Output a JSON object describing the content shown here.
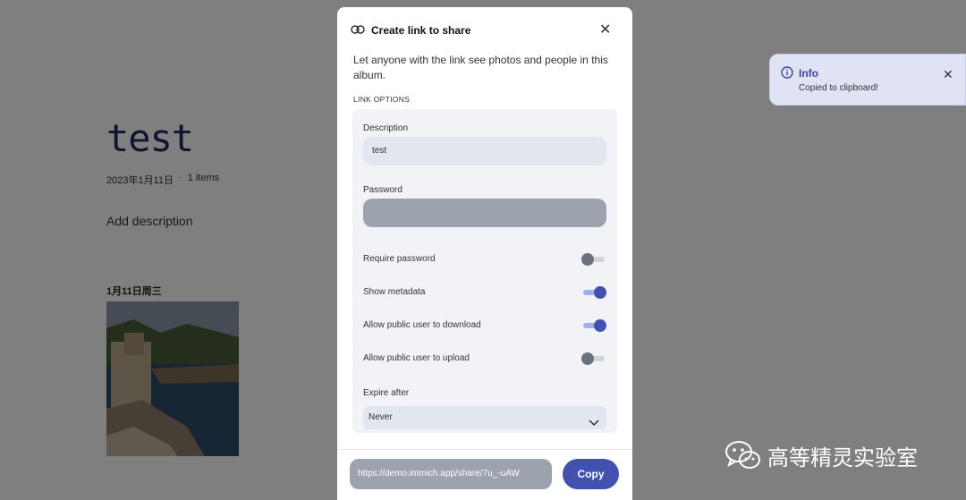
{
  "album": {
    "title": "test",
    "date": "2023年1月11日",
    "separator": "·",
    "item_count": "1 items",
    "add_description": "Add description",
    "group_date": "1月11日周三"
  },
  "toast": {
    "title": "Info",
    "message": "Copied to clipboard!",
    "icon": "info-icon",
    "close_icon": "close-icon"
  },
  "modal": {
    "title": "Create link to share",
    "description": "Let anyone with the link see photos and people in this album.",
    "options_label": "LINK OPTIONS",
    "description_field": {
      "label": "Description",
      "value": "test"
    },
    "password_field": {
      "label": "Password",
      "value": ""
    },
    "toggles": [
      {
        "label": "Require password",
        "on": false
      },
      {
        "label": "Show metadata",
        "on": true
      },
      {
        "label": "Allow public user to download",
        "on": true
      },
      {
        "label": "Allow public user to upload",
        "on": false
      }
    ],
    "expire": {
      "label": "Expire after",
      "value": "Never"
    },
    "share_url": "https://demo.immich.app/share/7u_-uAW",
    "copy_label": "Copy"
  },
  "watermark": {
    "text": "高等精灵实验室"
  },
  "colors": {
    "accent": "#4250af",
    "title": "#1e2a63",
    "toast_bg": "#dfe3f4"
  }
}
